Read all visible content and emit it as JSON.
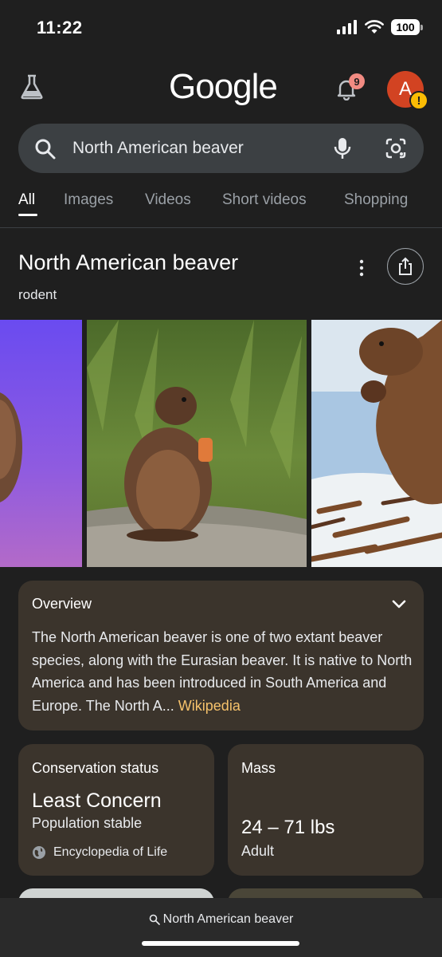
{
  "status_bar": {
    "time": "11:22",
    "battery": "100"
  },
  "header": {
    "logo": "Google",
    "notification_count": "9",
    "avatar_letter": "A",
    "avatar_alert": "!"
  },
  "search": {
    "query": "North American beaver"
  },
  "tabs": [
    "All",
    "Images",
    "Videos",
    "Short videos",
    "Shopping"
  ],
  "knowledge_panel": {
    "title": "North American beaver",
    "subtitle": "rodent",
    "overview": {
      "heading": "Overview",
      "text": "The North American beaver is one of two extant beaver species, along with the Eurasian beaver. It is native to North America and has been introduced in South America and Europe. The North A...",
      "source_link": "Wikipedia"
    },
    "conservation": {
      "heading": "Conservation status",
      "value": "Least Concern",
      "detail": "Population stable",
      "source": "Encyclopedia of Life"
    },
    "mass": {
      "heading": "Mass",
      "value": "24 – 71 lbs",
      "detail": "Adult"
    }
  },
  "bottom_bar": {
    "query": "North American beaver"
  },
  "colors": {
    "background": "#1f1f1f",
    "search_bg": "#3c4043",
    "card_bg": "#3b342c",
    "link": "#f6c26b",
    "avatar": "#d24322",
    "badge": "#f28b82"
  },
  "icons": [
    "labs-flask-icon",
    "bell-icon",
    "search-icon",
    "mic-icon",
    "lens-icon",
    "more-vert-icon",
    "share-icon",
    "chevron-down-icon",
    "globe-icon"
  ]
}
